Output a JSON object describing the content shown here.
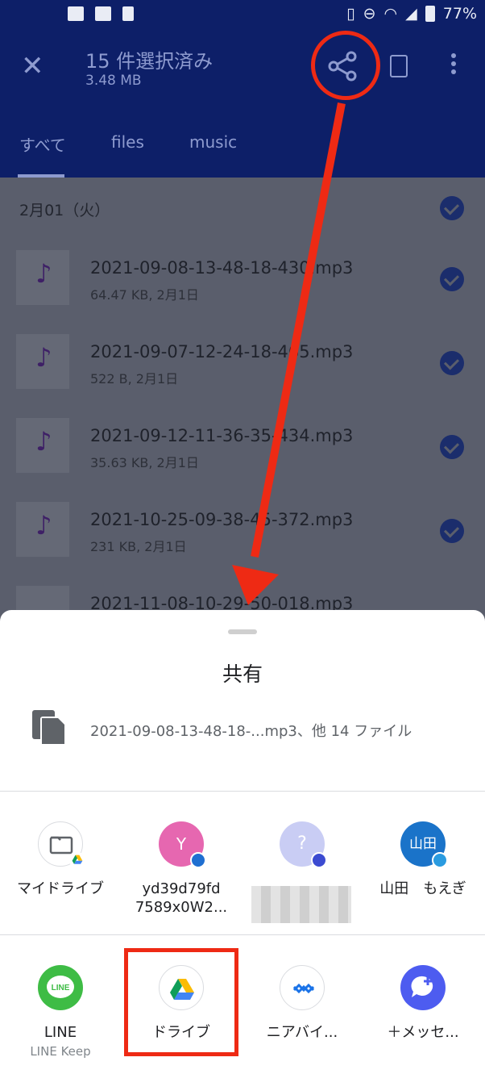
{
  "status_bar": {
    "battery": "77%"
  },
  "toolbar": {
    "selection_title": "15 件選択済み",
    "selection_size": "3.48 MB"
  },
  "tabs": [
    {
      "label": "すべて"
    },
    {
      "label": "files"
    },
    {
      "label": "music"
    }
  ],
  "date_header": "2月01（火）",
  "files": [
    {
      "name": "2021-09-08-13-48-18-430.mp3",
      "meta": "64.47 KB, 2月1日"
    },
    {
      "name": "2021-09-07-12-24-18-465.mp3",
      "meta": "522 B, 2月1日"
    },
    {
      "name": "2021-09-12-11-36-35-434.mp3",
      "meta": "35.63 KB, 2月1日"
    },
    {
      "name": "2021-10-25-09-38-45-372.mp3",
      "meta": "231 KB, 2月1日"
    },
    {
      "name": "2021-11-08-10-29-50-018.mp3",
      "meta": ""
    }
  ],
  "share_sheet": {
    "title": "共有",
    "description": "2021-09-08-13-48-18-...mp3、他 14 ファイル",
    "direct_targets": [
      {
        "label": "マイドライブ",
        "avatar": "",
        "color": "#ffffff"
      },
      {
        "label": "yd39d79fd 7589x0W2...",
        "avatar": "Y",
        "color": "#e667b0"
      },
      {
        "label": "",
        "avatar": "?",
        "color": "#c9cdf4"
      },
      {
        "label": "山田　もえぎ",
        "avatar": "山田",
        "color": "#1a73c9"
      }
    ],
    "apps": [
      {
        "label": "LINE",
        "sub": "LINE Keep",
        "color": "#3ebc45"
      },
      {
        "label": "ドライブ",
        "sub": "",
        "color": "#ffffff"
      },
      {
        "label": "ニアバイ...",
        "sub": "",
        "color": "#ffffff"
      },
      {
        "label": "＋メッセ...",
        "sub": "",
        "color": "#4d5cf0"
      }
    ]
  }
}
